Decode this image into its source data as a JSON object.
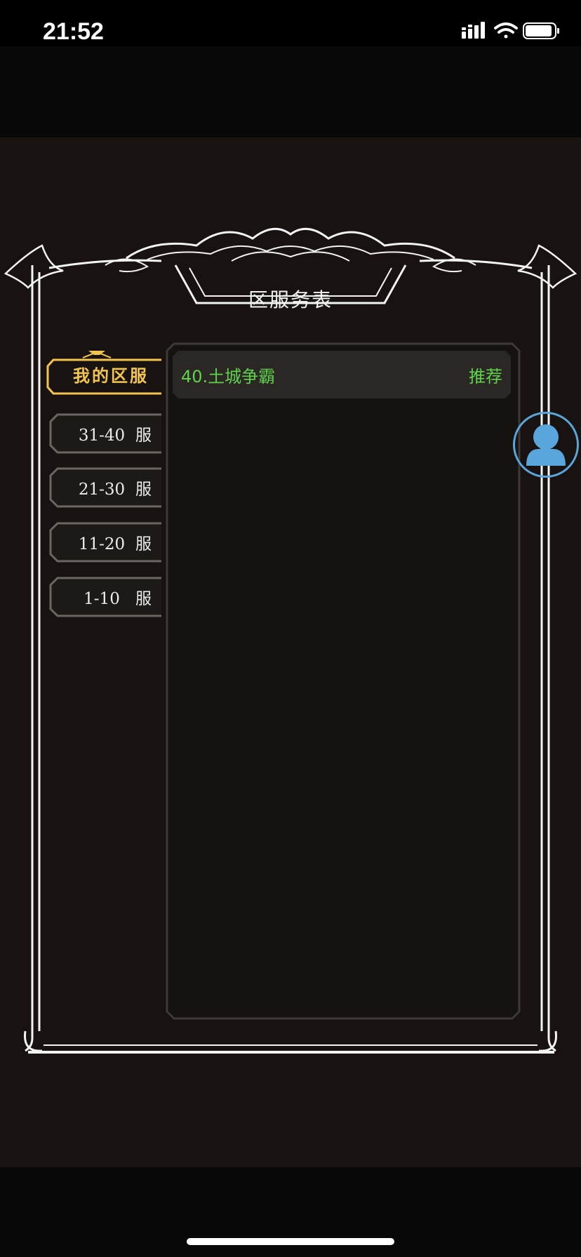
{
  "status_bar": {
    "time": "21:52"
  },
  "frame": {
    "title": "区服务表"
  },
  "tabs": [
    {
      "label": "我的区服",
      "range": "",
      "suffix": "",
      "active": true
    },
    {
      "label": "",
      "range": "31-40",
      "suffix": "服",
      "active": false
    },
    {
      "label": "",
      "range": "21-30",
      "suffix": "服",
      "active": false
    },
    {
      "label": "",
      "range": "11-20",
      "suffix": "服",
      "active": false
    },
    {
      "label": "",
      "range": "1-10",
      "suffix": "服",
      "active": false
    }
  ],
  "servers": [
    {
      "name": "40.土城争霸",
      "tag": "推荐"
    }
  ],
  "colors": {
    "accent": "#f3c54f",
    "server_text": "#5ed24a",
    "support": "#5aa6dc",
    "background": "#181310"
  },
  "icons": {
    "support": "user-avatar-icon"
  }
}
